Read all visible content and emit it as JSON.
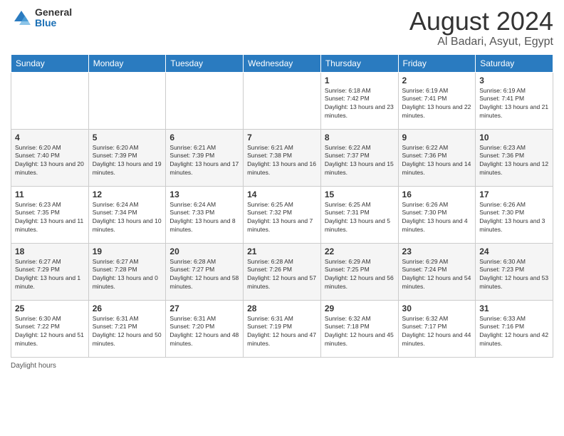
{
  "logo": {
    "general": "General",
    "blue": "Blue"
  },
  "title": "August 2024",
  "subtitle": "Al Badari, Asyut, Egypt",
  "days_of_week": [
    "Sunday",
    "Monday",
    "Tuesday",
    "Wednesday",
    "Thursday",
    "Friday",
    "Saturday"
  ],
  "footer": "Daylight hours",
  "weeks": [
    [
      {
        "day": "",
        "info": ""
      },
      {
        "day": "",
        "info": ""
      },
      {
        "day": "",
        "info": ""
      },
      {
        "day": "",
        "info": ""
      },
      {
        "day": "1",
        "info": "Sunrise: 6:18 AM\nSunset: 7:42 PM\nDaylight: 13 hours and 23 minutes."
      },
      {
        "day": "2",
        "info": "Sunrise: 6:19 AM\nSunset: 7:41 PM\nDaylight: 13 hours and 22 minutes."
      },
      {
        "day": "3",
        "info": "Sunrise: 6:19 AM\nSunset: 7:41 PM\nDaylight: 13 hours and 21 minutes."
      }
    ],
    [
      {
        "day": "4",
        "info": "Sunrise: 6:20 AM\nSunset: 7:40 PM\nDaylight: 13 hours and 20 minutes."
      },
      {
        "day": "5",
        "info": "Sunrise: 6:20 AM\nSunset: 7:39 PM\nDaylight: 13 hours and 19 minutes."
      },
      {
        "day": "6",
        "info": "Sunrise: 6:21 AM\nSunset: 7:39 PM\nDaylight: 13 hours and 17 minutes."
      },
      {
        "day": "7",
        "info": "Sunrise: 6:21 AM\nSunset: 7:38 PM\nDaylight: 13 hours and 16 minutes."
      },
      {
        "day": "8",
        "info": "Sunrise: 6:22 AM\nSunset: 7:37 PM\nDaylight: 13 hours and 15 minutes."
      },
      {
        "day": "9",
        "info": "Sunrise: 6:22 AM\nSunset: 7:36 PM\nDaylight: 13 hours and 14 minutes."
      },
      {
        "day": "10",
        "info": "Sunrise: 6:23 AM\nSunset: 7:36 PM\nDaylight: 13 hours and 12 minutes."
      }
    ],
    [
      {
        "day": "11",
        "info": "Sunrise: 6:23 AM\nSunset: 7:35 PM\nDaylight: 13 hours and 11 minutes."
      },
      {
        "day": "12",
        "info": "Sunrise: 6:24 AM\nSunset: 7:34 PM\nDaylight: 13 hours and 10 minutes."
      },
      {
        "day": "13",
        "info": "Sunrise: 6:24 AM\nSunset: 7:33 PM\nDaylight: 13 hours and 8 minutes."
      },
      {
        "day": "14",
        "info": "Sunrise: 6:25 AM\nSunset: 7:32 PM\nDaylight: 13 hours and 7 minutes."
      },
      {
        "day": "15",
        "info": "Sunrise: 6:25 AM\nSunset: 7:31 PM\nDaylight: 13 hours and 5 minutes."
      },
      {
        "day": "16",
        "info": "Sunrise: 6:26 AM\nSunset: 7:30 PM\nDaylight: 13 hours and 4 minutes."
      },
      {
        "day": "17",
        "info": "Sunrise: 6:26 AM\nSunset: 7:30 PM\nDaylight: 13 hours and 3 minutes."
      }
    ],
    [
      {
        "day": "18",
        "info": "Sunrise: 6:27 AM\nSunset: 7:29 PM\nDaylight: 13 hours and 1 minute."
      },
      {
        "day": "19",
        "info": "Sunrise: 6:27 AM\nSunset: 7:28 PM\nDaylight: 13 hours and 0 minutes."
      },
      {
        "day": "20",
        "info": "Sunrise: 6:28 AM\nSunset: 7:27 PM\nDaylight: 12 hours and 58 minutes."
      },
      {
        "day": "21",
        "info": "Sunrise: 6:28 AM\nSunset: 7:26 PM\nDaylight: 12 hours and 57 minutes."
      },
      {
        "day": "22",
        "info": "Sunrise: 6:29 AM\nSunset: 7:25 PM\nDaylight: 12 hours and 56 minutes."
      },
      {
        "day": "23",
        "info": "Sunrise: 6:29 AM\nSunset: 7:24 PM\nDaylight: 12 hours and 54 minutes."
      },
      {
        "day": "24",
        "info": "Sunrise: 6:30 AM\nSunset: 7:23 PM\nDaylight: 12 hours and 53 minutes."
      }
    ],
    [
      {
        "day": "25",
        "info": "Sunrise: 6:30 AM\nSunset: 7:22 PM\nDaylight: 12 hours and 51 minutes."
      },
      {
        "day": "26",
        "info": "Sunrise: 6:31 AM\nSunset: 7:21 PM\nDaylight: 12 hours and 50 minutes."
      },
      {
        "day": "27",
        "info": "Sunrise: 6:31 AM\nSunset: 7:20 PM\nDaylight: 12 hours and 48 minutes."
      },
      {
        "day": "28",
        "info": "Sunrise: 6:31 AM\nSunset: 7:19 PM\nDaylight: 12 hours and 47 minutes."
      },
      {
        "day": "29",
        "info": "Sunrise: 6:32 AM\nSunset: 7:18 PM\nDaylight: 12 hours and 45 minutes."
      },
      {
        "day": "30",
        "info": "Sunrise: 6:32 AM\nSunset: 7:17 PM\nDaylight: 12 hours and 44 minutes."
      },
      {
        "day": "31",
        "info": "Sunrise: 6:33 AM\nSunset: 7:16 PM\nDaylight: 12 hours and 42 minutes."
      }
    ]
  ]
}
